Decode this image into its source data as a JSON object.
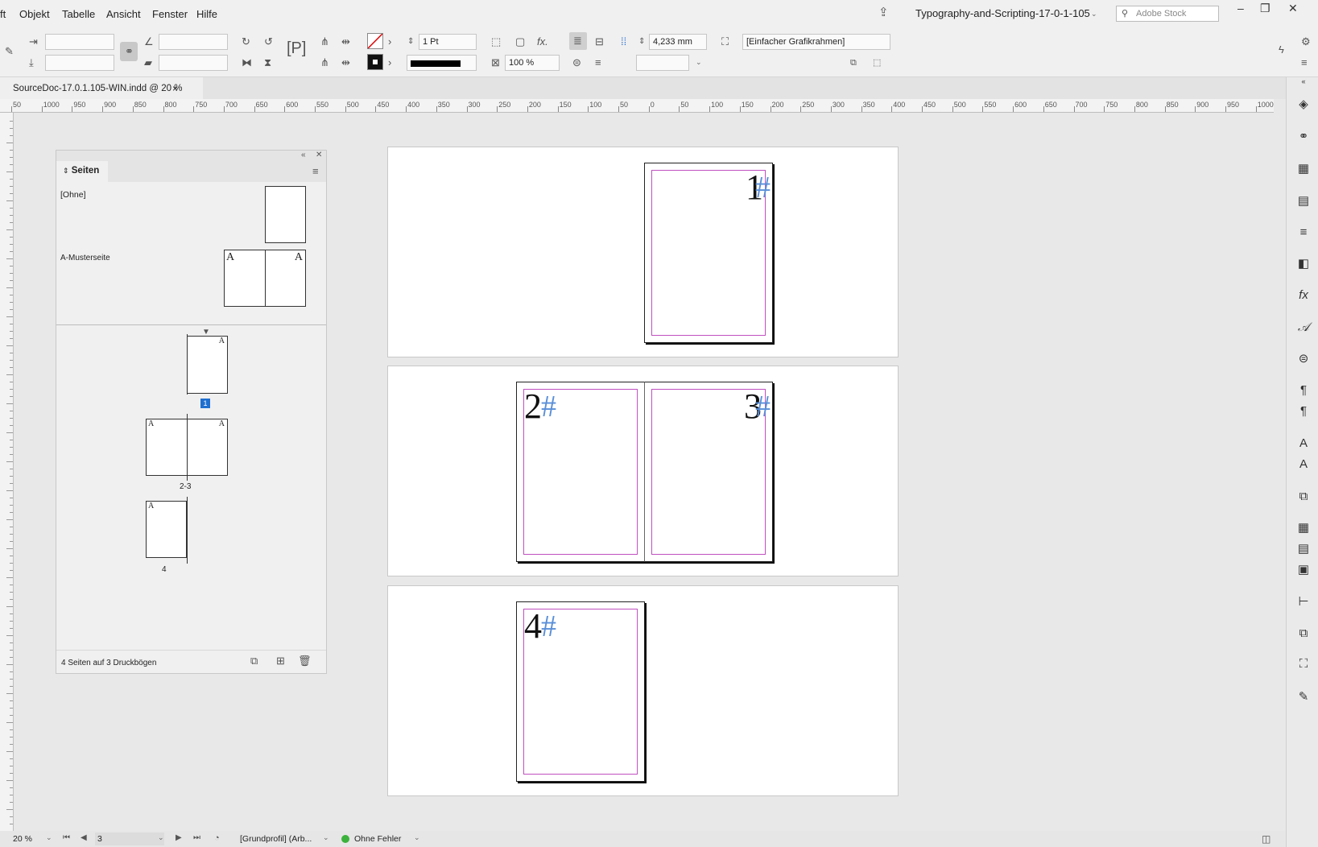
{
  "menu": {
    "items": [
      "ft",
      "Objekt",
      "Tabelle",
      "Ansicht",
      "Fenster",
      "Hilfe"
    ],
    "doc_title": "Typography-and-Scripting-17-0-1-105",
    "stock_placeholder": "Adobe Stock"
  },
  "control": {
    "stroke_weight": "1 Pt",
    "opacity": "100 %",
    "offset": "4,233 mm",
    "object_style": "[Einfacher Grafikrahmen]"
  },
  "tab": {
    "label": "SourceDoc-17.0.1.105-WIN.indd @ 20 %",
    "close": "×"
  },
  "ruler": {
    "h_ticks": [
      "50",
      "1000",
      "950",
      "900",
      "850",
      "800",
      "750",
      "700",
      "650",
      "600",
      "550",
      "500",
      "450",
      "400",
      "350",
      "300",
      "250",
      "200",
      "150",
      "100",
      "50",
      "0",
      "50",
      "100",
      "150",
      "200",
      "250",
      "300",
      "350",
      "400",
      "450",
      "500",
      "550",
      "600",
      "650",
      "700",
      "750",
      "800",
      "850",
      "900",
      "950",
      "1000"
    ]
  },
  "pages_panel": {
    "tab_label": "Seiten",
    "none_master": "[Ohne]",
    "master_name": "A-Musterseite",
    "master_letter": "A",
    "page1_label": "1",
    "spread_label": "2-3",
    "page4_label": "4",
    "thumb_letters": {
      "p1": "A",
      "p2": "A",
      "p3": "A",
      "p4": "A"
    },
    "footer": "4 Seiten auf 3 Druckbögen"
  },
  "spreads": {
    "p1": "1",
    "p2": "2",
    "p3": "3",
    "p4": "4",
    "hash": "#"
  },
  "status": {
    "zoom": "20 %",
    "page": "3",
    "profile": "[Grundprofil] (Arb...",
    "errors": "Ohne Fehler"
  }
}
